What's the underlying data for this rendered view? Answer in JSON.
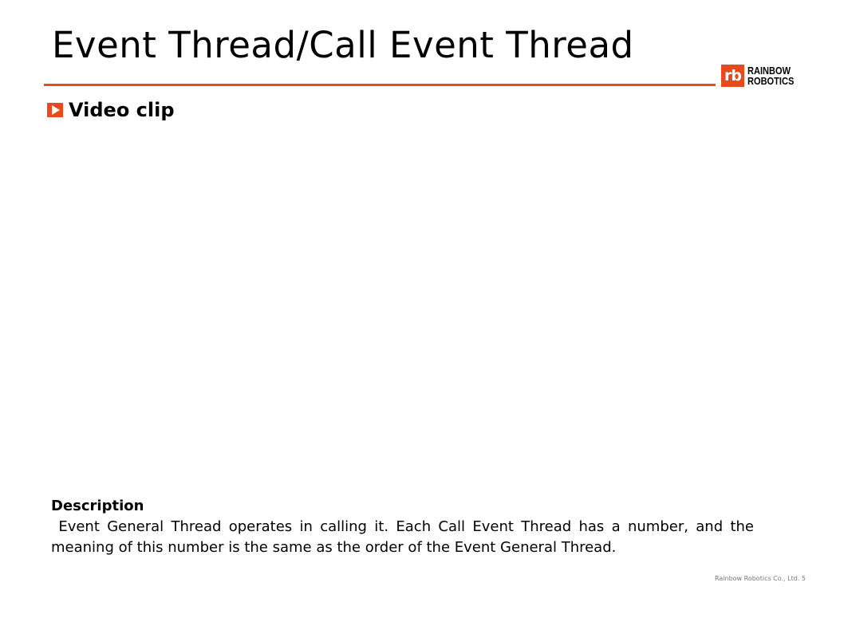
{
  "title": "Event Thread/Call Event Thread",
  "logo": {
    "mark": "rb",
    "line1": "RAINBOW",
    "line2": "ROBOTICS"
  },
  "section": {
    "label": "Video clip"
  },
  "description": {
    "heading": "Description",
    "body": " Event General Thread operates in calling it. Each Call Event Thread has a number, and the meaning of this number is the same as the order of the Event General Thread."
  },
  "footer": "Rainbow Robotics Co., Ltd. 5",
  "colors": {
    "accent": "#e8491d"
  }
}
